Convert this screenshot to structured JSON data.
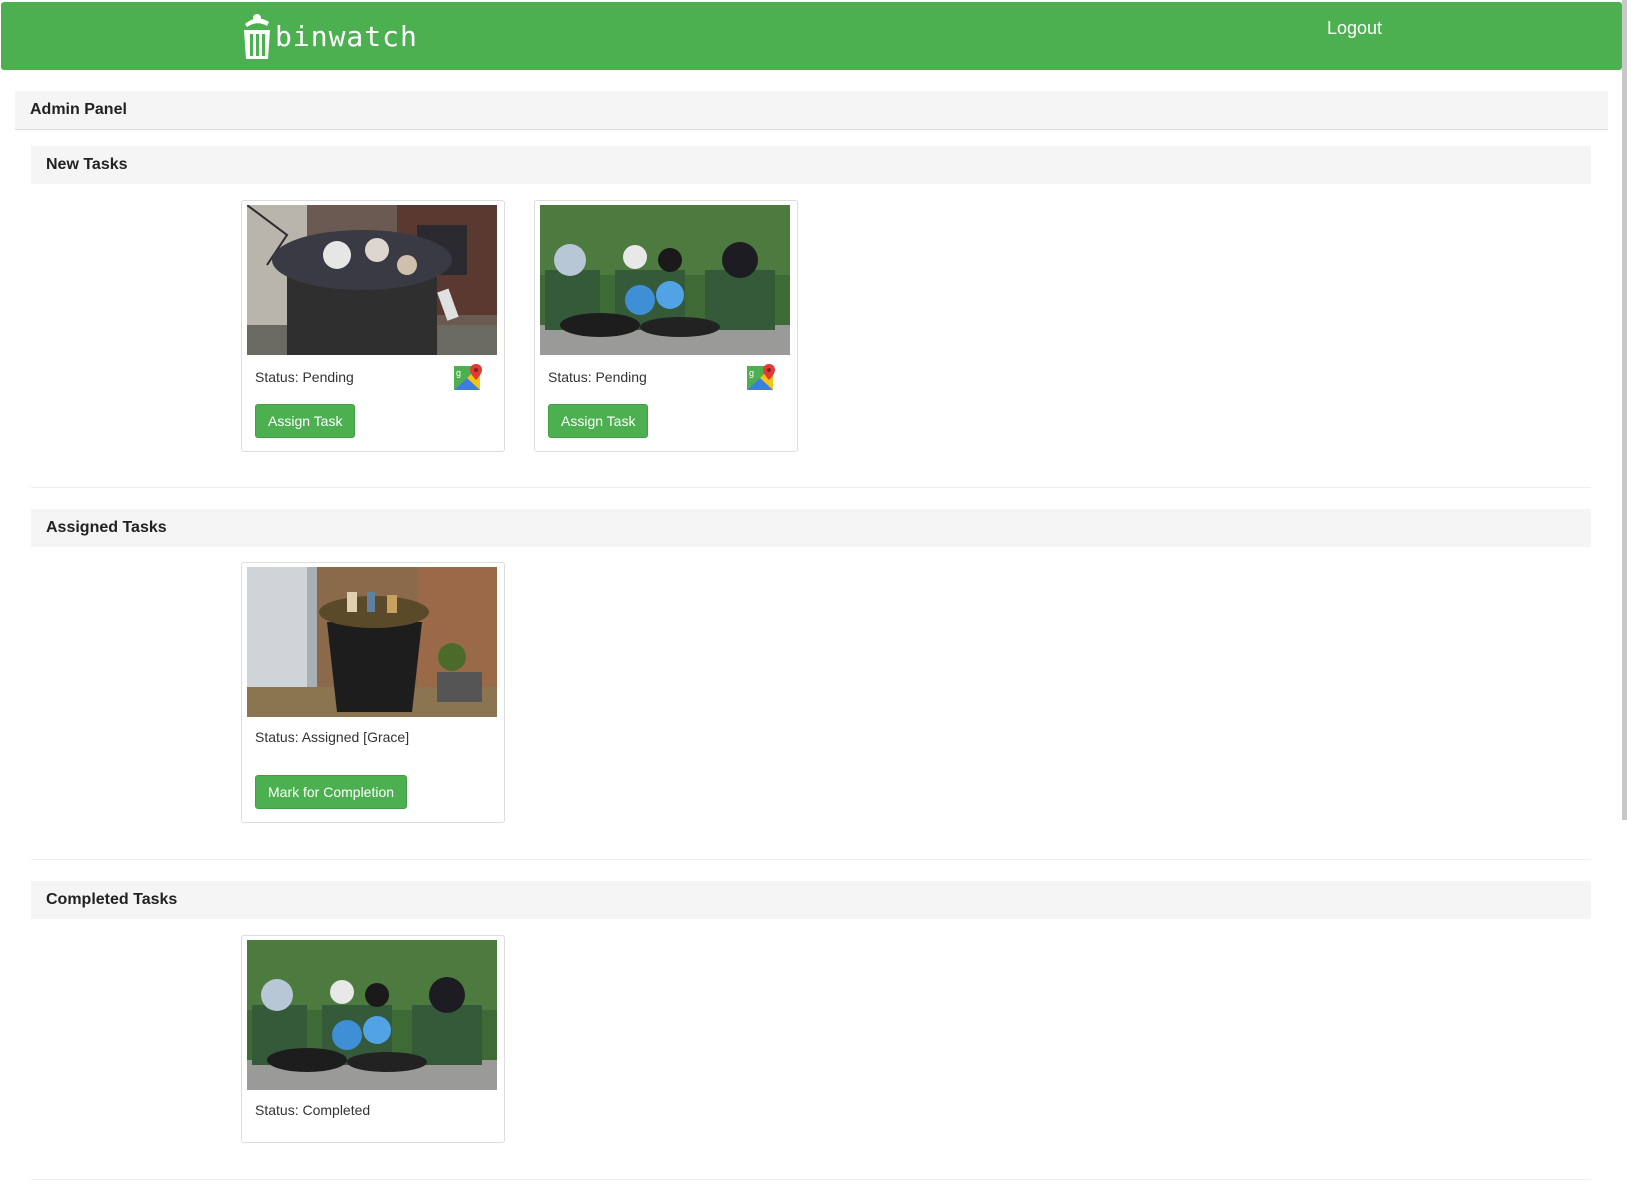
{
  "navbar": {
    "brand": "binwatch",
    "logout_label": "Logout",
    "color": "#4cb050"
  },
  "admin_panel": {
    "title": "Admin Panel"
  },
  "sections": {
    "new": {
      "title": "New Tasks",
      "cards": [
        {
          "status": "Status: Pending",
          "button": "Assign Task",
          "icon": "google-maps-icon",
          "image": "overflowing-dumpster"
        },
        {
          "status": "Status: Pending",
          "button": "Assign Task",
          "icon": "google-maps-icon",
          "image": "three-green-bins-with-bags"
        }
      ]
    },
    "assigned": {
      "title": "Assigned Tasks",
      "cards": [
        {
          "status": "Status: Assigned [Grace]",
          "button": "Mark for Completion",
          "image": "black-wheelie-bin-overflowing"
        }
      ]
    },
    "completed": {
      "title": "Completed Tasks",
      "cards": [
        {
          "status": "Status: Completed",
          "image": "three-green-bins-with-bags"
        }
      ]
    }
  }
}
